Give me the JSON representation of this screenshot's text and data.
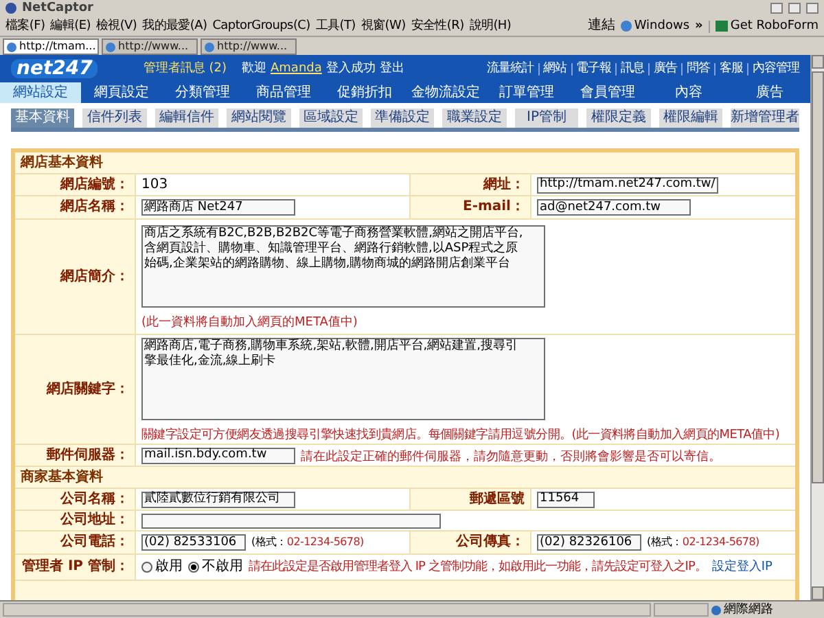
{
  "browser": {
    "title": "NetCaptor",
    "menu": [
      "檔案(F)",
      "編輯(E)",
      "檢視(V)",
      "我的最愛(A)",
      "CaptorGroups(C)",
      "工具(T)",
      "視窗(W)",
      "安全性(R)",
      "說明(H)"
    ],
    "links_label": "連結",
    "link": "Windows",
    "chevron": "»",
    "roboform": "Get RoboForm",
    "tabs": [
      {
        "label": "http://tmam...",
        "selected": true
      },
      {
        "label": "http://www...",
        "selected": false
      },
      {
        "label": "http://www...",
        "selected": false
      }
    ]
  },
  "header": {
    "logo": "net247",
    "notice": "管理者訊息 (2)",
    "welcome": "歡迎",
    "user": "Amanda",
    "login": "登入成功",
    "logout": "登出",
    "links": [
      "流量統計",
      "網站",
      "電子報",
      "訊息",
      "廣告",
      "問答",
      "客服",
      "內容管理"
    ],
    "nav": [
      {
        "label": "網站設定",
        "selected": true
      },
      {
        "label": "網頁設定",
        "selected": false
      },
      {
        "label": "分類管理",
        "selected": false
      },
      {
        "label": "商品管理",
        "selected": false
      },
      {
        "label": "促銷折扣",
        "selected": false
      },
      {
        "label": "金物流設定",
        "selected": false
      },
      {
        "label": "訂單管理",
        "selected": false
      },
      {
        "label": "會員管理",
        "selected": false
      },
      {
        "label": "內容",
        "selected": false
      },
      {
        "label": "廣告",
        "selected": false
      }
    ]
  },
  "subtabs": [
    {
      "label": "基本資料",
      "selected": true
    },
    {
      "label": "信件列表",
      "selected": false
    },
    {
      "label": "編輯信件",
      "selected": false
    },
    {
      "label": "網站閱覽",
      "selected": false
    },
    {
      "label": "區域設定",
      "selected": false
    },
    {
      "label": "準備設定",
      "selected": false
    },
    {
      "label": "職業設定",
      "selected": false
    },
    {
      "label": "IP管制",
      "selected": false
    },
    {
      "label": "權限定義",
      "selected": false
    },
    {
      "label": "權限編輯",
      "selected": false
    },
    {
      "label": "新增管理者",
      "selected": false
    }
  ],
  "sections": [
    {
      "title": "網店基本資料",
      "rows": [
        {
          "cells": [
            {
              "label": "網店編號：",
              "kind": "text",
              "value": "103"
            },
            {
              "label": "網址：",
              "kind": "input",
              "value": "http://tmam.net247.com.tw/"
            }
          ]
        },
        {
          "cells": [
            {
              "label": "網店名稱：",
              "kind": "input",
              "value": "網路商店 Net247"
            },
            {
              "label": "E-mail：",
              "kind": "input",
              "value": "ad@net247.com.tw"
            }
          ]
        },
        {
          "cells": [
            {
              "label": "網店簡介：",
              "kind": "textarea",
              "value": "商店之系統有B2C,B2B,B2B2C等電子商務營業軟體,網站之開店平台,含網頁設計、購物車、知識管理平台、網路行銷軟體,以ASP程式之原始碼,企業架站的網路購物、線上購物,購物商城的網路開店創業平台",
              "note": "(此一資料將自動加入網頁的META值中)"
            }
          ]
        },
        {
          "cells": [
            {
              "label": "網店關鍵字：",
              "kind": "textarea",
              "value": "網路商店,電子商務,購物車系統,架站,軟體,開店平台,網站建置,搜尋引擎最佳化,金流,線上刷卡",
              "note": "關鍵字設定可方便網友透過搜尋引擎快速找到貴網店。每個關鍵字請用逗號分開。(此一資料將自動加入網頁的META值中)"
            }
          ]
        },
        {
          "cells": [
            {
              "label": "郵件伺服器：",
              "kind": "input",
              "value": "mail.isn.bdy.com.tw",
              "note": "請在此設定正確的郵件伺服器，請勿隨意更動，否則將會影響是否可以寄信。"
            }
          ]
        }
      ]
    },
    {
      "title": "商家基本資料",
      "rows": [
        {
          "cells": [
            {
              "label": "公司名稱：",
              "kind": "input",
              "value": "貳陸貳數位行銷有限公司"
            },
            {
              "label": "郵遞區號",
              "kind": "short",
              "value": "11564"
            }
          ]
        },
        {
          "cells": [
            {
              "label": "公司地址：",
              "kind": "wide"
            }
          ]
        },
        {
          "cells": [
            {
              "label": "公司電話：",
              "kind": "input",
              "value": "(02) 82533106",
              "hint": "(格式：",
              "example": "02-1234-5678)"
            },
            {
              "label": "公司傳真：",
              "kind": "input",
              "value": "(02) 82326106",
              "hint": "(格式：",
              "example": "02-1234-5678)"
            }
          ]
        },
        {
          "cells": [
            {
              "label": "管理者 IP 管制：",
              "kind": "radio",
              "options": [
                {
                  "label": "啟用",
                  "selected": false
                },
                {
                  "label": "不啟用",
                  "selected": true
                }
              ],
              "note": "請在此設定是否啟用管理者登入 IP 之管制功能，如啟用此一功能，請先設定可登入之IP。",
              "link": "設定登入IP"
            }
          ]
        }
      ]
    }
  ],
  "status": "網際網路"
}
